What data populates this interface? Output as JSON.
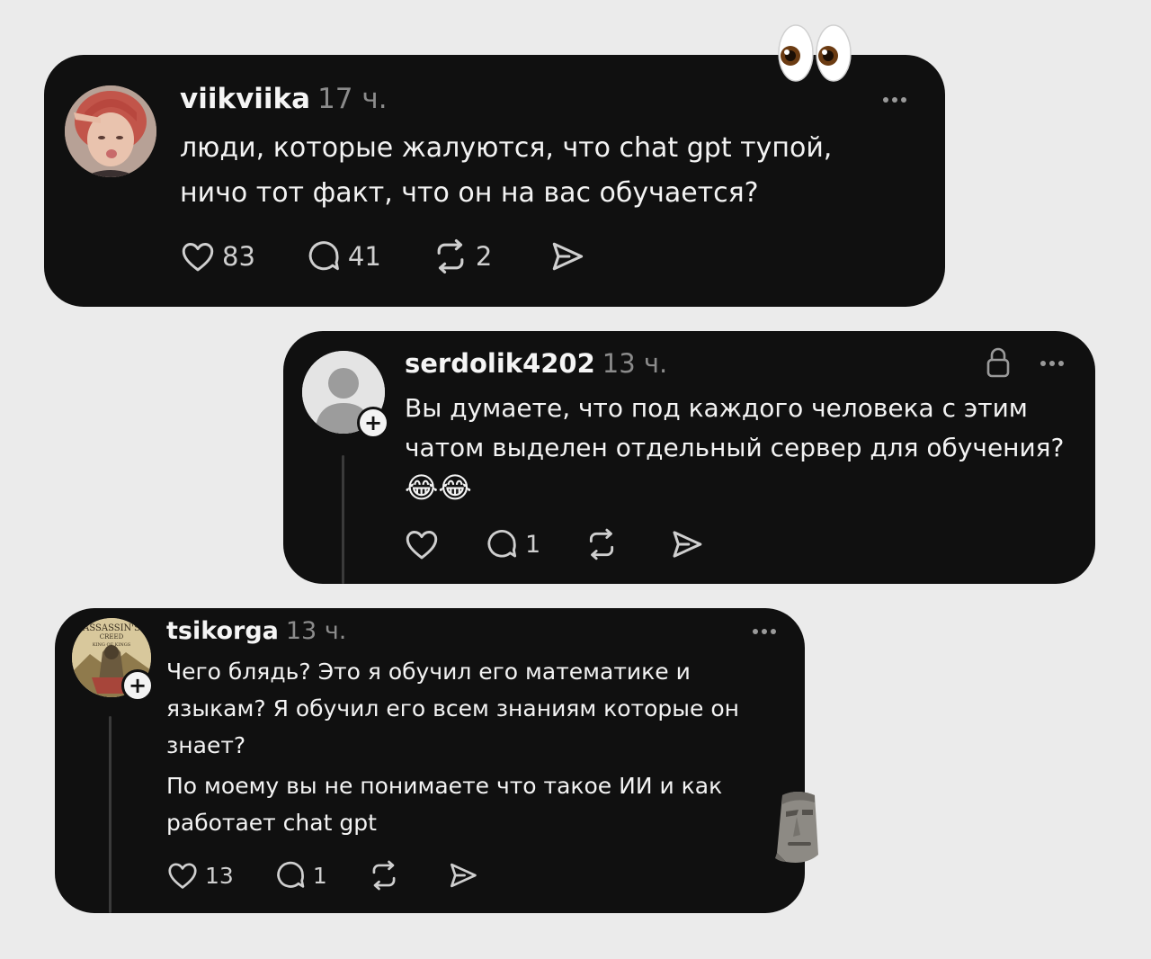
{
  "posts": [
    {
      "username": "viikviika",
      "time": "17 ч.",
      "lines": [
        "люди, которые жалуются, что chat gpt тупой,",
        "ничо тот факт, что он на вас обучается?"
      ],
      "likes": "83",
      "replies": "41",
      "reposts": "2"
    },
    {
      "username": "serdolik4202",
      "time": "13 ч.",
      "lines": [
        "Вы думаете, что под каждого человека с этим",
        "чатом выделен отдельный сервер для обучения?"
      ],
      "emoji": "😂😂",
      "likes": "",
      "replies": "1",
      "reposts": ""
    },
    {
      "username": "tsikorga",
      "time": "13 ч.",
      "lines": [
        "Чего блядь? Это я обучил его математике и",
        "языкам? Я обучил его всем знаниям которые он",
        "знает?",
        "По моему вы не понимаете что такое ИИ и как",
        "работает chat gpt"
      ],
      "likes": "13",
      "replies": "1",
      "reposts": "",
      "avatar_text": [
        "ASSASSIN'S",
        "CREED",
        "KING OF KINGS"
      ]
    }
  ],
  "stickers": {
    "top": "eyes-emoji",
    "bottom": "moai-face"
  },
  "colors": {
    "background": "#ebebeb",
    "card": "#101010",
    "text": "#f3f3f3",
    "muted": "#8b8b8b"
  }
}
